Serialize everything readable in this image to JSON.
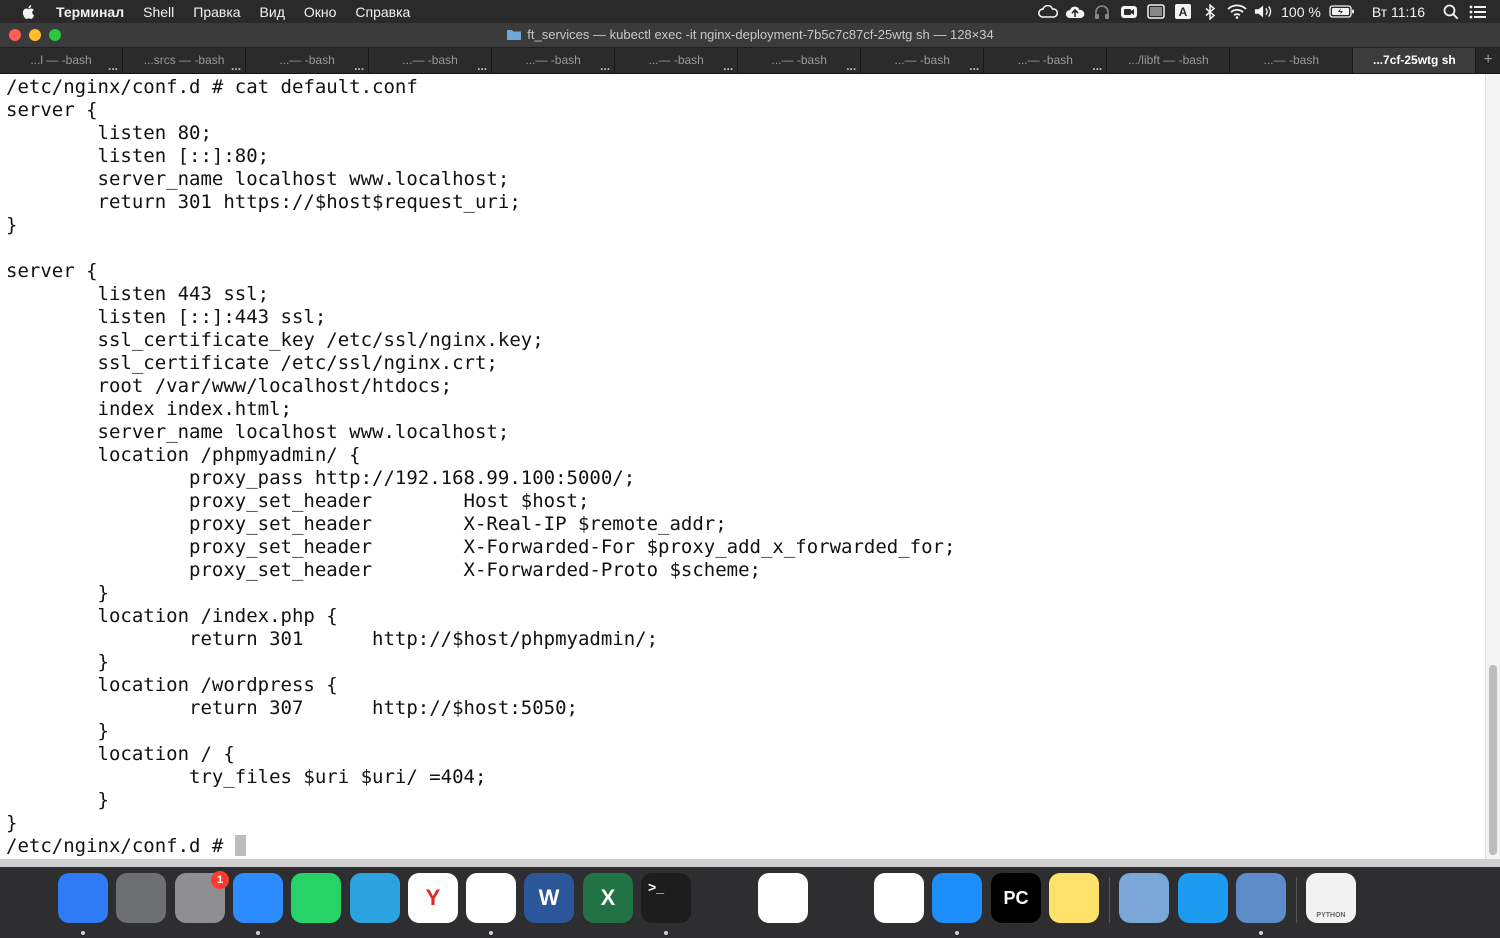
{
  "menubar": {
    "app_name": "Терминал",
    "items": [
      "Shell",
      "Правка",
      "Вид",
      "Окно",
      "Справка"
    ],
    "battery": "100 %",
    "clock": "Вт 11:16",
    "status_icons": [
      "creative-cloud-icon",
      "cloud-upload-icon",
      "headphones-icon",
      "zoom-icon",
      "screen-icon",
      "keyboard-layout-icon",
      "bluetooth-icon",
      "wifi-icon",
      "volume-icon",
      "battery-icon",
      "spotlight-search-icon",
      "control-center-icon"
    ],
    "keyboard_layout": "A"
  },
  "window": {
    "title": "ft_services — kubectl exec -it nginx-deployment-7b5c7c87cf-25wtg sh — 128×34"
  },
  "tabs": [
    {
      "label": "...l — -bash"
    },
    {
      "label": "...srcs — -bash"
    },
    {
      "label": "...— -bash"
    },
    {
      "label": "...— -bash"
    },
    {
      "label": "...— -bash"
    },
    {
      "label": "...— -bash"
    },
    {
      "label": "...— -bash"
    },
    {
      "label": "...— -bash"
    },
    {
      "label": "...— -bash"
    },
    {
      "label": ".../libft — -bash"
    },
    {
      "label": "...— -bash"
    },
    {
      "label": "...7cf-25wtg sh"
    }
  ],
  "tab_more_glyph": "...",
  "tab_add_glyph": "+",
  "terminal": {
    "lines": [
      "/etc/nginx/conf.d # cat default.conf",
      "server {",
      "        listen 80;",
      "        listen [::]:80;",
      "        server_name localhost www.localhost;",
      "        return 301 https://$host$request_uri;",
      "}",
      "",
      "server {",
      "        listen 443 ssl;",
      "        listen [::]:443 ssl;",
      "        ssl_certificate_key /etc/ssl/nginx.key;",
      "        ssl_certificate /etc/ssl/nginx.crt;",
      "        root /var/www/localhost/htdocs;",
      "        index index.html;",
      "        server_name localhost www.localhost;",
      "        location /phpmyadmin/ {",
      "                proxy_pass http://192.168.99.100:5000/;",
      "                proxy_set_header        Host $host;",
      "                proxy_set_header        X-Real-IP $remote_addr;",
      "                proxy_set_header        X-Forwarded-For $proxy_add_x_forwarded_for;",
      "                proxy_set_header        X-Forwarded-Proto $scheme;",
      "        }",
      "        location /index.php {",
      "                return 301      http://$host/phpmyadmin/;",
      "        }",
      "        location /wordpress {",
      "                return 307      http://$host:5050;",
      "        }",
      "        location / {",
      "                try_files $uri $uri/ =404;",
      "        }",
      "}"
    ],
    "prompt": "/etc/nginx/conf.d # "
  },
  "dock": {
    "apps": [
      {
        "name": "finder-icon",
        "glyph": "",
        "color": "#2f7bf5",
        "running": true
      },
      {
        "name": "launchpad-icon",
        "glyph": "",
        "color": "#6d6f73",
        "running": false
      },
      {
        "name": "system-preferences-icon",
        "glyph": "",
        "color": "#8e8e93",
        "running": false,
        "badge": "1"
      },
      {
        "name": "zoom-icon",
        "glyph": "",
        "color": "#2d8cff",
        "running": true
      },
      {
        "name": "whatsapp-icon",
        "glyph": "",
        "color": "#25d366",
        "running": false
      },
      {
        "name": "telegram-icon",
        "glyph": "",
        "color": "#2aa3df",
        "running": false
      },
      {
        "name": "yandex-browser-icon",
        "glyph": "Y",
        "color": "#ffffff",
        "running": false
      },
      {
        "name": "chrome-icon",
        "glyph": "",
        "color": "#ffffff",
        "running": true
      },
      {
        "name": "word-icon",
        "glyph": "W",
        "color": "#2b579a",
        "running": false
      },
      {
        "name": "excel-icon",
        "glyph": "X",
        "color": "#217346",
        "running": false
      },
      {
        "name": "terminal-icon",
        "glyph": ">_",
        "color": "#1d1d1d",
        "running": true
      },
      {
        "name": "qt-creator-icon",
        "glyph": "",
        "color": "#2e2e30",
        "running": false
      },
      {
        "name": "vscode-icon",
        "glyph": "",
        "color": "#ffffff",
        "running": false
      },
      {
        "name": "cleanmymac-icon",
        "glyph": "",
        "color": "#2e2e30",
        "running": false
      },
      {
        "name": "slack-icon",
        "glyph": "",
        "color": "#ffffff",
        "running": false
      },
      {
        "name": "safari-icon",
        "glyph": "",
        "color": "#1c8ef9",
        "running": true
      },
      {
        "name": "pycharm-icon",
        "glyph": "PC",
        "color": "#000000",
        "running": false
      },
      {
        "name": "notes-icon",
        "glyph": "",
        "color": "#ffe26b",
        "running": false
      },
      {
        "name": "preview-icon",
        "glyph": "",
        "color": "#7aa7d6",
        "running": false
      },
      {
        "name": "docker-icon",
        "glyph": "",
        "color": "#1d9bf0",
        "running": false
      },
      {
        "name": "virtualbox-icon",
        "glyph": "",
        "color": "#5e8cc9",
        "running": true
      },
      {
        "name": "python-file-icon",
        "glyph": "PYTHON",
        "color": "#f2f2f2",
        "running": false
      },
      {
        "name": "trash-icon",
        "glyph": "",
        "color": "#2e2e30",
        "running": false
      }
    ]
  }
}
